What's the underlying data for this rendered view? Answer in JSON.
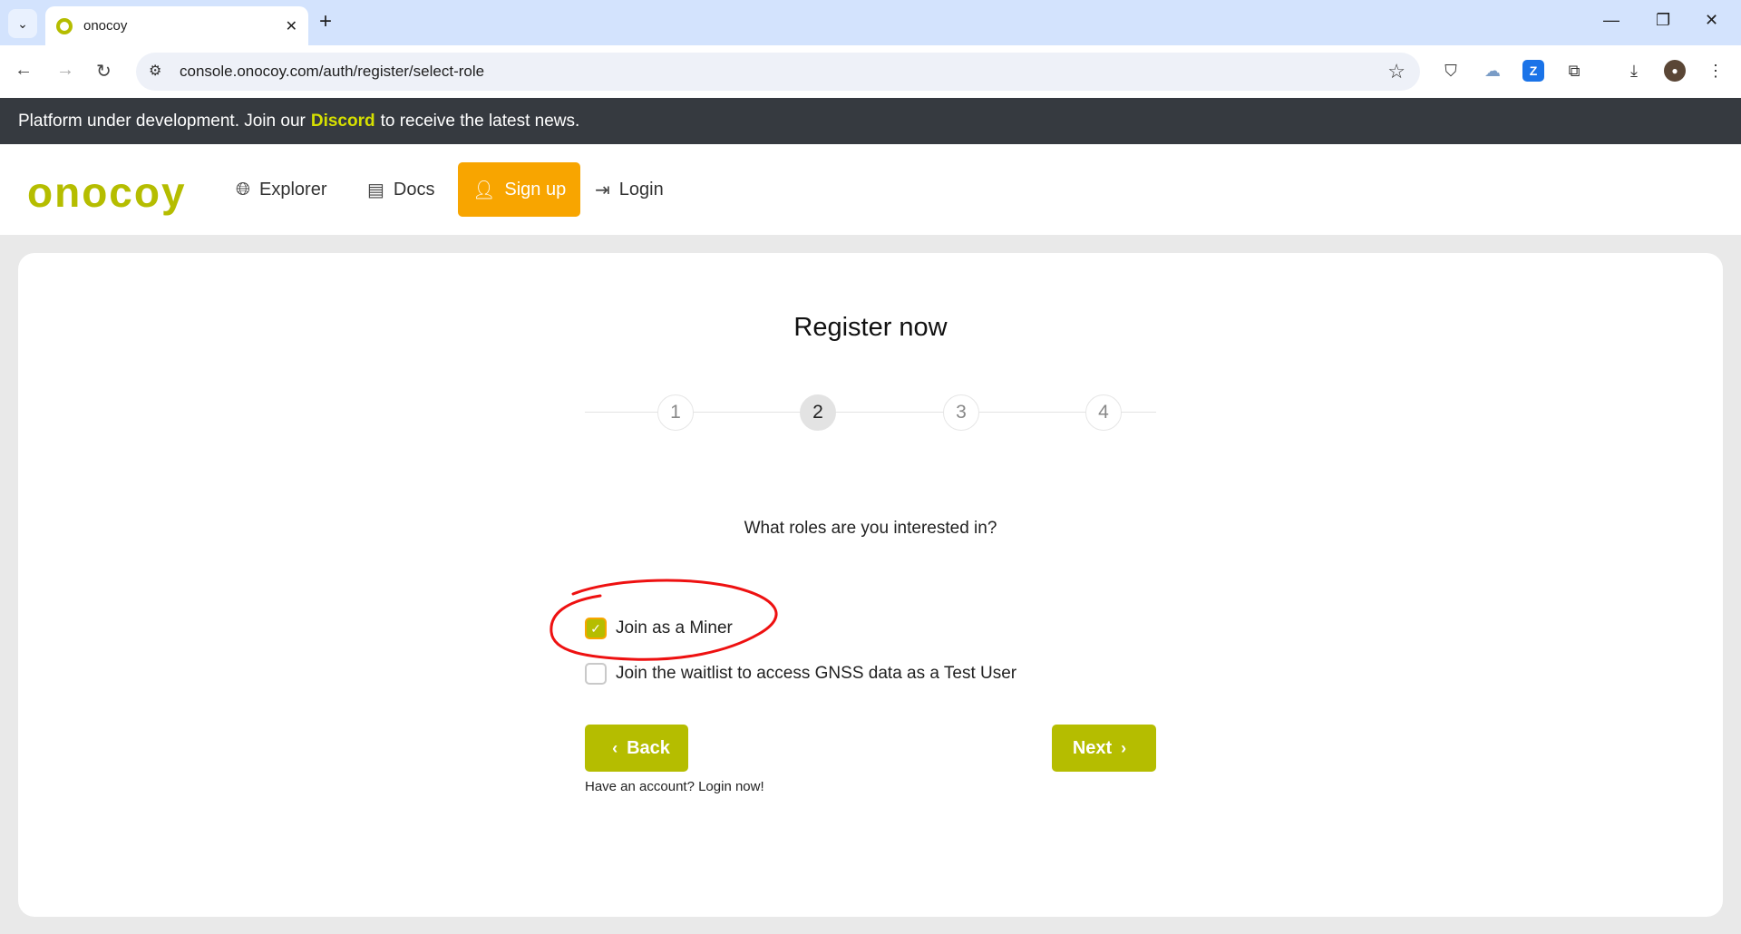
{
  "browser": {
    "tab_title": "onocoy",
    "url": "console.onocoy.com/auth/register/select-role"
  },
  "banner": {
    "prefix": "Platform under development. Join our",
    "link": "Discord",
    "suffix": "to receive the latest news."
  },
  "header": {
    "logo": "onocoy",
    "nav": {
      "explorer": "Explorer",
      "docs": "Docs",
      "signup": "Sign up",
      "login": "Login"
    }
  },
  "register": {
    "title": "Register now",
    "steps": [
      "1",
      "2",
      "3",
      "4"
    ],
    "active_step": 2,
    "question": "What roles are you interested in?",
    "options": [
      {
        "label": "Join as a Miner",
        "checked": true
      },
      {
        "label": "Join the waitlist to access GNSS data as a Test User",
        "checked": false
      }
    ],
    "back_label": "Back",
    "next_label": "Next",
    "login_hint": "Have an account? Login now!"
  },
  "colors": {
    "accent": "#b5bd00",
    "signup": "#f8a500",
    "banner_bg": "#363a40",
    "banner_link": "#d6e000",
    "annotation": "#ee1111"
  }
}
